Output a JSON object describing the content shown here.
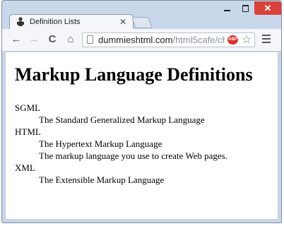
{
  "browser": {
    "tab": {
      "title": "Definition Lists"
    },
    "window_controls": {
      "close_symbol": "✕"
    },
    "toolbar": {
      "back_icon": "←",
      "forward_icon": "→",
      "reload_icon": "C",
      "home_icon": "⌂",
      "url_host": "dummieshtml.com",
      "url_path": "/html5cafe/ch",
      "extension_badge": "ABP",
      "star_icon": "☆"
    },
    "colors": {
      "close_button": "#d9423a",
      "frame": "#c9d7ea",
      "extension_badge": "#d6322b"
    }
  },
  "page": {
    "heading": "Markup Language Definitions",
    "definitions": [
      {
        "term": "SGML",
        "descriptions": [
          "The Standard Generalized Markup Language"
        ]
      },
      {
        "term": "HTML",
        "descriptions": [
          "The Hypertext Markup Language",
          "The markup language you use to create Web pages."
        ]
      },
      {
        "term": "XML",
        "descriptions": [
          "The Extensible Markup Language"
        ]
      }
    ]
  }
}
